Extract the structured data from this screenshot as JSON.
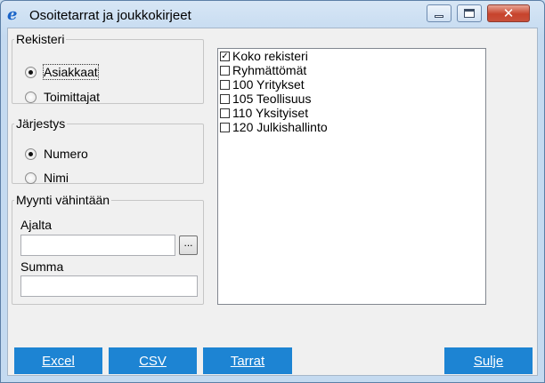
{
  "window": {
    "title": "Osoitetarrat ja joukkokirjeet",
    "app_icon": "e-logo-icon"
  },
  "registers": {
    "legend": "Rekisteri",
    "options": [
      {
        "label": "Asiakkaat",
        "checked": true
      },
      {
        "label": "Toimittajat",
        "checked": false
      }
    ]
  },
  "order": {
    "legend": "Järjestys",
    "options": [
      {
        "label": "Numero",
        "checked": true
      },
      {
        "label": "Nimi",
        "checked": false
      }
    ]
  },
  "sales": {
    "legend": "Myynti vähintään",
    "period_label": "Ajalta",
    "period_value": "",
    "browse_label": "...",
    "amount_label": "Summa",
    "amount_value": ""
  },
  "groups": {
    "items": [
      {
        "label": "Koko rekisteri",
        "checked": true
      },
      {
        "label": "Ryhmättömät",
        "checked": false
      },
      {
        "label": "100 Yritykset",
        "checked": false
      },
      {
        "label": "105 Teollisuus",
        "checked": false
      },
      {
        "label": "110 Yksityiset",
        "checked": false
      },
      {
        "label": "120 Julkishallinto",
        "checked": false
      }
    ]
  },
  "buttons": {
    "excel": "Excel",
    "csv": "CSV",
    "labels": "Tarrat",
    "close": "Sulje"
  },
  "colors": {
    "button_blue": "#1d84d3",
    "title_bar": "#c4daf0"
  }
}
